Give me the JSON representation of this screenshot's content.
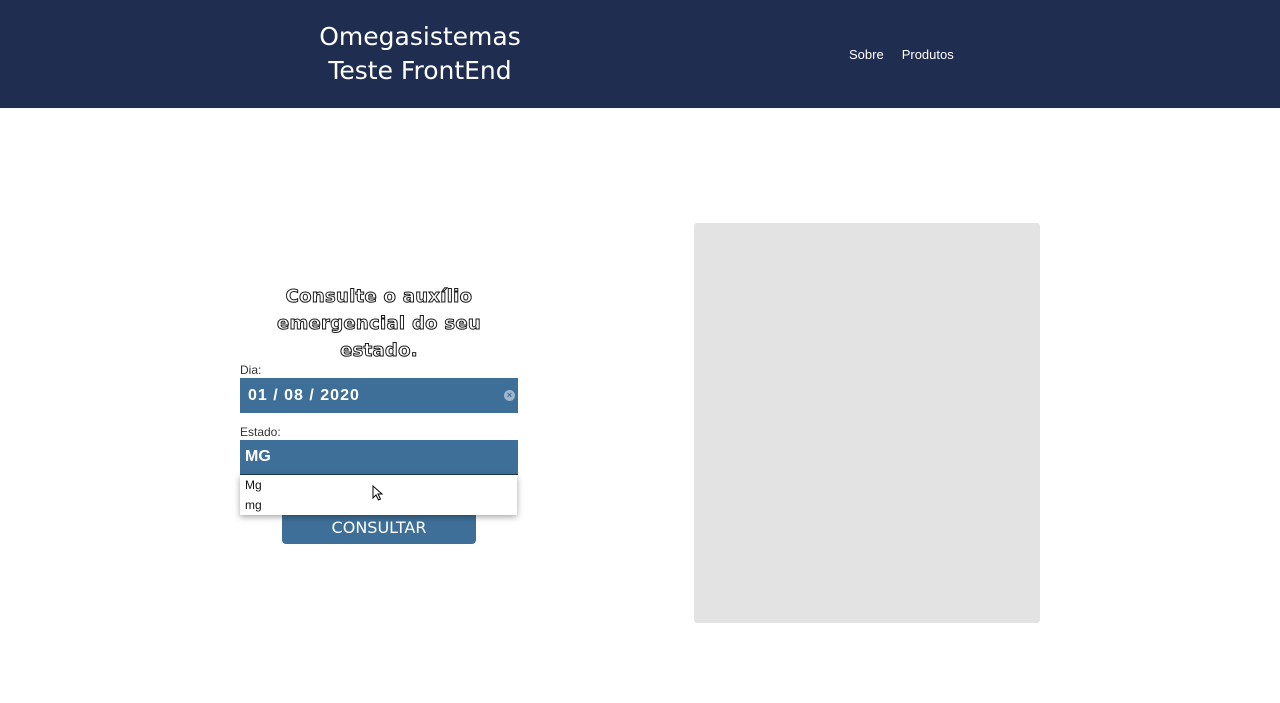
{
  "header": {
    "brand_line1": "Omegasistemas",
    "brand_line2": "Teste FrontEnd",
    "nav": [
      {
        "label": "Sobre"
      },
      {
        "label": "Produtos"
      }
    ],
    "background_color": "#1f2d50"
  },
  "form": {
    "title": "Consulte o auxílio emergencial do seu estado.",
    "date_label": "Dia:",
    "date_value": "01 / 08 / 2020",
    "state_label": "Estado:",
    "state_value": "MG",
    "autocomplete_options": [
      "Mg",
      "mg"
    ],
    "submit_label": "CONSULTAR",
    "accent_color": "#3e6f98"
  },
  "icons": {
    "date_clear": "clear-icon",
    "pointer": "mouse-pointer-icon"
  },
  "chart_panel": {
    "background_color": "#e3e3e3"
  }
}
